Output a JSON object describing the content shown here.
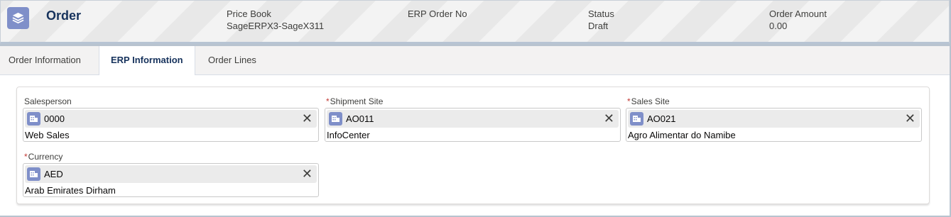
{
  "header": {
    "object_icon": "order-stack-icon",
    "title": "Order",
    "fields": [
      {
        "label": "Price Book",
        "value": "SageERPX3-SageX311"
      },
      {
        "label": "ERP Order No",
        "value": ""
      },
      {
        "label": "Status",
        "value": "Draft"
      },
      {
        "label": "Order Amount",
        "value": "0.00"
      }
    ]
  },
  "tabs": [
    {
      "label": "Order Information",
      "active": false
    },
    {
      "label": "ERP Information",
      "active": true
    },
    {
      "label": "Order Lines",
      "active": false
    }
  ],
  "erp": {
    "salesperson": {
      "label": "Salesperson",
      "required": false,
      "code": "0000",
      "description": "Web Sales"
    },
    "shipment_site": {
      "label": "Shipment Site",
      "required": true,
      "code": "AO011",
      "description": "InfoCenter"
    },
    "sales_site": {
      "label": "Sales Site",
      "required": true,
      "code": "AO021",
      "description": "Agro Alimentar do Namibe"
    },
    "currency": {
      "label": "Currency",
      "required": true,
      "code": "AED",
      "description": "Arab Emirates Dirham"
    },
    "required_marker": "*",
    "remove_glyph": "✕",
    "record_icon": "record-icon"
  },
  "colors": {
    "icon_bg": "#7f8fc9",
    "required": "#c23934",
    "title": "#16325c"
  }
}
